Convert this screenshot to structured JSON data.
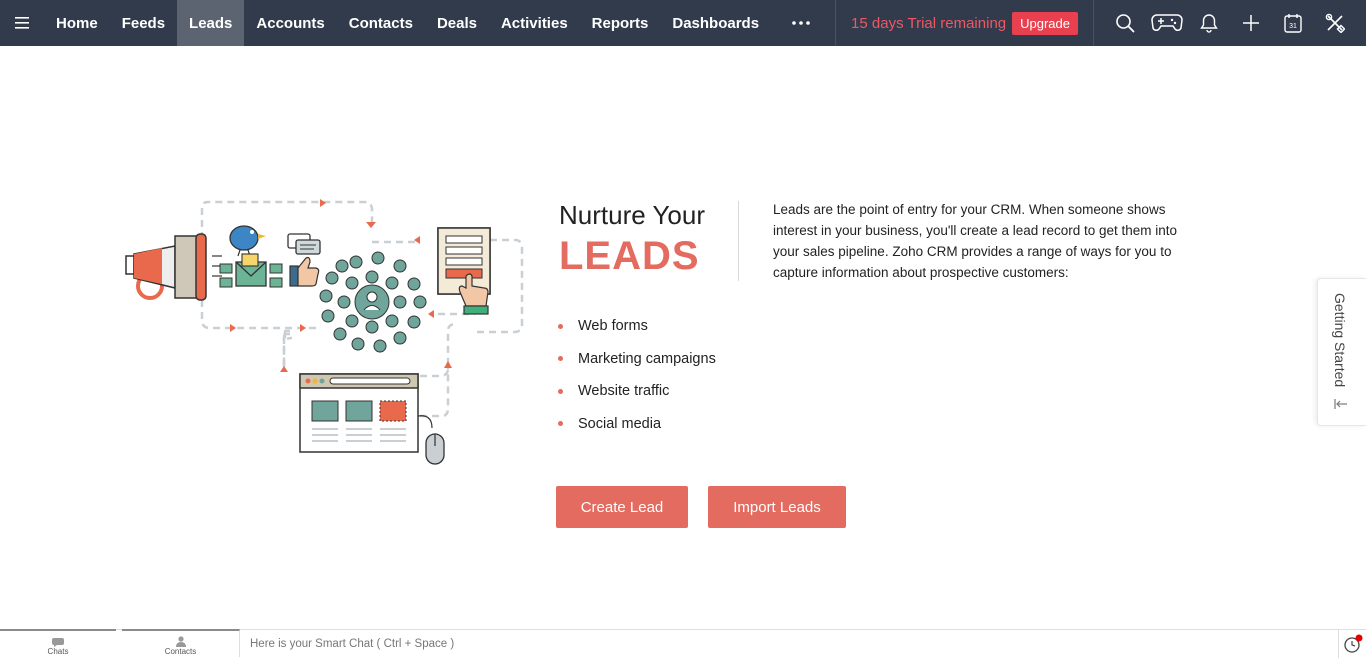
{
  "nav": {
    "items": [
      {
        "label": "Home"
      },
      {
        "label": "Feeds"
      },
      {
        "label": "Leads"
      },
      {
        "label": "Accounts"
      },
      {
        "label": "Contacts"
      },
      {
        "label": "Deals"
      },
      {
        "label": "Activities"
      },
      {
        "label": "Reports"
      },
      {
        "label": "Dashboards"
      }
    ],
    "active": "Leads",
    "more_icon": "ellipsis-icon"
  },
  "trial": {
    "text": "15 days Trial remaining",
    "upgrade_label": "Upgrade"
  },
  "toolbar_icons": [
    "search-icon",
    "gamepad-icon",
    "bell-icon",
    "plus-icon",
    "calendar-icon",
    "tools-icon"
  ],
  "calendar_day": "31",
  "hero": {
    "heading_top": "Nurture Your",
    "heading_big": "LEADS",
    "description": "Leads are the point of entry for your CRM. When someone shows interest in your business, you'll create a lead record to get them into your sales pipeline. Zoho CRM provides a range of ways for you to capture information about prospective customers:",
    "bullets": [
      "Web forms",
      "Marketing campaigns",
      "Website traffic",
      "Social media"
    ],
    "create_label": "Create Lead",
    "import_label": "Import Leads"
  },
  "side_tab": {
    "label": "Getting Started"
  },
  "bottom": {
    "chats_label": "Chats",
    "contacts_label": "Contacts",
    "smart_chat_placeholder": "Here is your Smart Chat ( Ctrl + Space )"
  },
  "colors": {
    "topbar": "#323b4c",
    "accent": "#e36b60",
    "trial_text": "#ef5764",
    "upgrade": "#e8404f"
  }
}
